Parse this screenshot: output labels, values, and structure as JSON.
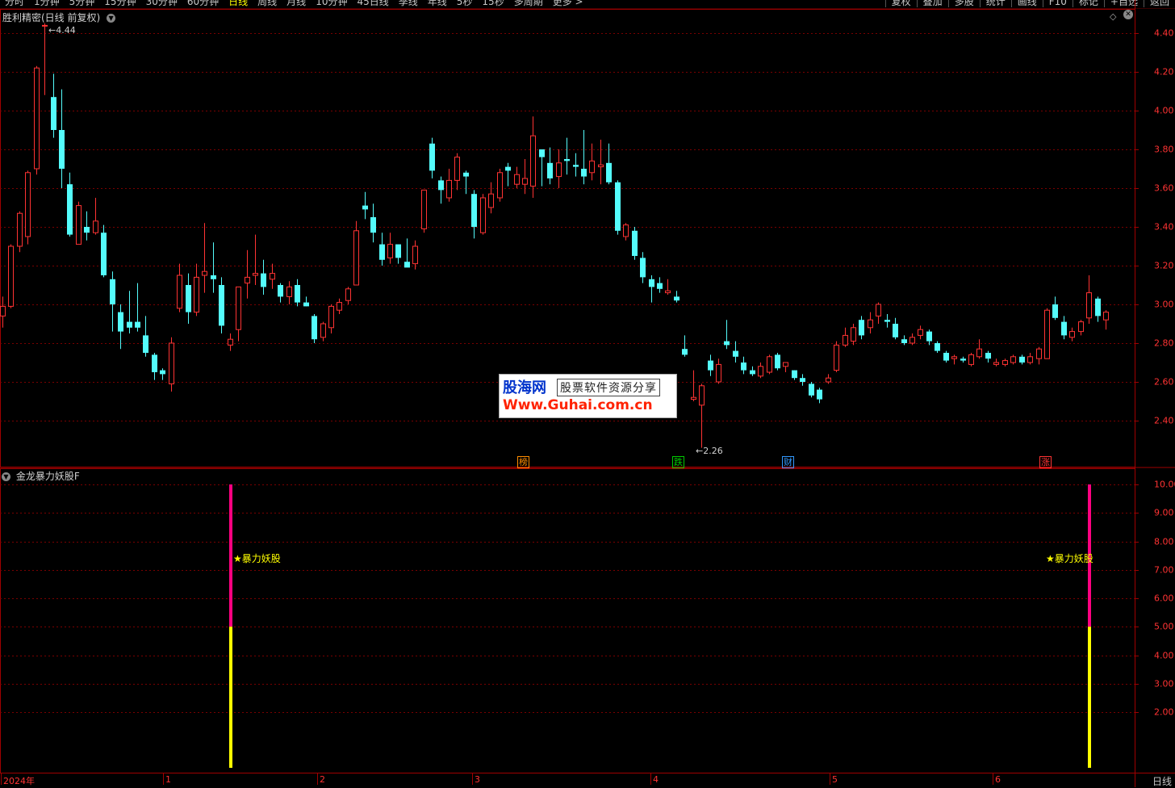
{
  "toolbar": {
    "periods": [
      "分时",
      "1分钟",
      "5分钟",
      "15分钟",
      "30分钟",
      "60分钟",
      "日线",
      "周线",
      "月线",
      "10分钟",
      "45日线",
      "季线",
      "年线",
      "5秒",
      "15秒",
      "多周期",
      "更多 >"
    ],
    "active_period": "日线",
    "tools": [
      "复权",
      "叠加",
      "多股",
      "统计",
      "画线",
      "F10",
      "标记",
      "+自选",
      "返回"
    ]
  },
  "main_panel": {
    "title": "胜利精密(日线 前复权)",
    "y_ticks": [
      "4.40",
      "4.20",
      "4.00",
      "3.80",
      "3.60",
      "3.40",
      "3.20",
      "3.00",
      "2.80",
      "2.60",
      "2.40"
    ],
    "high_label": "4.44",
    "low_label": "2.26",
    "events": [
      {
        "label": "榜",
        "color": "#ff8c00"
      },
      {
        "label": "跌",
        "color": "#00cc00"
      },
      {
        "label": "财",
        "color": "#3399ff"
      },
      {
        "label": "涨",
        "color": "#ff3333"
      }
    ]
  },
  "indicator_panel": {
    "title": "金龙暴力妖股F",
    "y_ticks": [
      "10.00",
      "9.00",
      "8.00",
      "7.00",
      "6.00",
      "5.00",
      "4.00",
      "3.00",
      "2.00"
    ],
    "signal_label": "★暴力妖股"
  },
  "x_axis": {
    "labels": [
      "2024年",
      "1",
      "2",
      "3",
      "4",
      "5",
      "6"
    ],
    "period_button": "日线"
  },
  "watermark": {
    "logo": "股海网",
    "slogan": "股票软件资源分享",
    "url": "Www.Guhai.com.cn"
  },
  "chart_data": {
    "type": "candlestick",
    "colors": {
      "up": "#ff3333",
      "down": "#54fcfc",
      "grid": "#7a0000",
      "signal_top": "#ff0080",
      "signal_bottom": "#ffff00"
    },
    "ylim": [
      2.2,
      4.5
    ],
    "candles": [
      [
        2.94,
        2.99,
        3.04,
        2.88
      ],
      [
        2.99,
        3.3,
        3.31,
        2.98
      ],
      [
        3.3,
        3.47,
        3.48,
        3.27
      ],
      [
        3.35,
        3.68,
        3.69,
        3.31
      ],
      [
        3.7,
        4.22,
        4.23,
        3.67
      ],
      [
        4.44,
        4.44,
        4.45,
        4.08
      ],
      [
        4.07,
        3.9,
        4.19,
        3.86
      ],
      [
        3.9,
        3.7,
        4.11,
        3.6
      ],
      [
        3.62,
        3.36,
        3.68,
        3.35
      ],
      [
        3.31,
        3.51,
        3.53,
        3.31
      ],
      [
        3.4,
        3.37,
        3.48,
        3.33
      ],
      [
        3.37,
        3.43,
        3.55,
        3.36
      ],
      [
        3.37,
        3.15,
        3.41,
        3.14
      ],
      [
        3.13,
        3.0,
        3.17,
        2.86
      ],
      [
        2.96,
        2.86,
        3.0,
        2.77
      ],
      [
        2.91,
        2.88,
        3.07,
        2.85
      ],
      [
        2.91,
        2.88,
        3.11,
        2.86
      ],
      [
        2.84,
        2.75,
        2.94,
        2.73
      ],
      [
        2.74,
        2.65,
        2.75,
        2.61
      ],
      [
        2.66,
        2.64,
        2.67,
        2.61
      ],
      [
        2.59,
        2.8,
        2.83,
        2.55
      ],
      [
        2.98,
        3.15,
        3.21,
        2.96
      ],
      [
        3.1,
        2.96,
        3.16,
        2.9
      ],
      [
        2.96,
        3.14,
        3.21,
        2.94
      ],
      [
        3.15,
        3.17,
        3.42,
        3.06
      ],
      [
        3.15,
        3.13,
        3.32,
        3.06
      ],
      [
        3.1,
        2.89,
        3.14,
        2.85
      ],
      [
        2.79,
        2.82,
        2.85,
        2.76
      ],
      [
        2.87,
        3.09,
        3.09,
        2.81
      ],
      [
        3.11,
        3.14,
        3.28,
        3.03
      ],
      [
        3.15,
        3.16,
        3.36,
        3.1
      ],
      [
        3.16,
        3.09,
        3.23,
        3.05
      ],
      [
        3.13,
        3.16,
        3.21,
        3.08
      ],
      [
        3.1,
        3.04,
        3.11,
        3.01
      ],
      [
        3.04,
        3.09,
        3.12,
        3.0
      ],
      [
        3.1,
        3.01,
        3.13,
        2.99
      ],
      [
        3.01,
        2.99,
        3.04,
        2.99
      ],
      [
        2.94,
        2.82,
        2.95,
        2.8
      ],
      [
        2.83,
        2.9,
        2.91,
        2.81
      ],
      [
        2.88,
        2.99,
        3.0,
        2.85
      ],
      [
        2.97,
        3.01,
        3.03,
        2.95
      ],
      [
        3.02,
        3.08,
        3.09,
        3.0
      ],
      [
        3.1,
        3.38,
        3.43,
        3.11
      ],
      [
        3.51,
        3.49,
        3.58,
        3.44
      ],
      [
        3.45,
        3.37,
        3.52,
        3.32
      ],
      [
        3.31,
        3.23,
        3.37,
        3.2
      ],
      [
        3.24,
        3.31,
        3.37,
        3.21
      ],
      [
        3.31,
        3.24,
        3.3,
        3.21
      ],
      [
        3.22,
        3.19,
        3.34,
        3.2
      ],
      [
        3.21,
        3.3,
        3.33,
        3.18
      ],
      [
        3.39,
        3.59,
        3.59,
        3.37
      ],
      [
        3.83,
        3.69,
        3.86,
        3.65
      ],
      [
        3.64,
        3.59,
        3.66,
        3.52
      ],
      [
        3.55,
        3.64,
        3.7,
        3.53
      ],
      [
        3.64,
        3.76,
        3.78,
        3.59
      ],
      [
        3.68,
        3.66,
        3.69,
        3.57
      ],
      [
        3.57,
        3.4,
        3.59,
        3.34
      ],
      [
        3.37,
        3.55,
        3.57,
        3.36
      ],
      [
        3.5,
        3.57,
        3.63,
        3.47
      ],
      [
        3.55,
        3.68,
        3.7,
        3.53
      ],
      [
        3.71,
        3.69,
        3.73,
        3.61
      ],
      [
        3.62,
        3.67,
        3.71,
        3.6
      ],
      [
        3.62,
        3.65,
        3.75,
        3.57
      ],
      [
        3.61,
        3.87,
        3.97,
        3.55
      ],
      [
        3.8,
        3.76,
        3.8,
        3.61
      ],
      [
        3.73,
        3.65,
        3.81,
        3.62
      ],
      [
        3.66,
        3.73,
        3.8,
        3.6
      ],
      [
        3.75,
        3.74,
        3.86,
        3.67
      ],
      [
        3.72,
        3.71,
        3.78,
        3.66
      ],
      [
        3.7,
        3.66,
        3.9,
        3.62
      ],
      [
        3.68,
        3.74,
        3.83,
        3.64
      ],
      [
        3.71,
        3.72,
        3.85,
        3.62
      ],
      [
        3.73,
        3.63,
        3.83,
        3.62
      ],
      [
        3.63,
        3.38,
        3.64,
        3.36
      ],
      [
        3.35,
        3.41,
        3.42,
        3.33
      ],
      [
        3.38,
        3.25,
        3.4,
        3.23
      ],
      [
        3.24,
        3.14,
        3.27,
        3.11
      ],
      [
        3.13,
        3.09,
        3.15,
        3.01
      ],
      [
        3.11,
        3.08,
        3.14,
        3.06
      ],
      [
        3.06,
        3.07,
        3.13,
        3.05
      ],
      [
        3.04,
        3.02,
        3.07,
        3.01
      ],
      [
        2.77,
        2.74,
        2.84,
        2.73
      ],
      [
        2.51,
        2.52,
        2.66,
        2.5
      ],
      [
        2.48,
        2.58,
        2.59,
        2.26
      ],
      [
        2.71,
        2.66,
        2.74,
        2.63
      ],
      [
        2.6,
        2.69,
        2.72,
        2.59
      ],
      [
        2.81,
        2.79,
        2.92,
        2.77
      ],
      [
        2.76,
        2.73,
        2.81,
        2.7
      ],
      [
        2.7,
        2.66,
        2.73,
        2.64
      ],
      [
        2.66,
        2.64,
        2.68,
        2.63
      ],
      [
        2.63,
        2.68,
        2.7,
        2.62
      ],
      [
        2.65,
        2.73,
        2.74,
        2.64
      ],
      [
        2.74,
        2.67,
        2.75,
        2.66
      ],
      [
        2.68,
        2.7,
        2.7,
        2.65
      ],
      [
        2.66,
        2.62,
        2.66,
        2.61
      ],
      [
        2.62,
        2.6,
        2.64,
        2.58
      ],
      [
        2.59,
        2.53,
        2.6,
        2.52
      ],
      [
        2.56,
        2.51,
        2.57,
        2.49
      ],
      [
        2.6,
        2.62,
        2.64,
        2.59
      ],
      [
        2.66,
        2.79,
        2.81,
        2.65
      ],
      [
        2.79,
        2.84,
        2.88,
        2.78
      ],
      [
        2.81,
        2.88,
        2.9,
        2.79
      ],
      [
        2.92,
        2.84,
        2.94,
        2.82
      ],
      [
        2.88,
        2.92,
        2.96,
        2.85
      ],
      [
        2.94,
        3.0,
        3.01,
        2.9
      ],
      [
        2.92,
        2.91,
        2.95,
        2.88
      ],
      [
        2.9,
        2.83,
        2.93,
        2.82
      ],
      [
        2.82,
        2.8,
        2.84,
        2.79
      ],
      [
        2.8,
        2.83,
        2.85,
        2.79
      ],
      [
        2.84,
        2.87,
        2.89,
        2.82
      ],
      [
        2.86,
        2.81,
        2.87,
        2.79
      ],
      [
        2.8,
        2.76,
        2.81,
        2.75
      ],
      [
        2.75,
        2.71,
        2.76,
        2.7
      ],
      [
        2.72,
        2.73,
        2.74,
        2.69
      ],
      [
        2.72,
        2.71,
        2.73,
        2.7
      ],
      [
        2.69,
        2.74,
        2.75,
        2.68
      ],
      [
        2.73,
        2.77,
        2.82,
        2.72
      ],
      [
        2.75,
        2.72,
        2.76,
        2.7
      ],
      [
        2.69,
        2.7,
        2.72,
        2.68
      ],
      [
        2.69,
        2.71,
        2.72,
        2.68
      ],
      [
        2.7,
        2.73,
        2.74,
        2.69
      ],
      [
        2.73,
        2.7,
        2.74,
        2.69
      ],
      [
        2.7,
        2.73,
        2.75,
        2.69
      ],
      [
        2.72,
        2.77,
        2.78,
        2.69
      ],
      [
        2.72,
        2.97,
        2.98,
        2.72
      ],
      [
        3.0,
        2.93,
        3.04,
        2.92
      ],
      [
        2.91,
        2.84,
        2.94,
        2.82
      ],
      [
        2.83,
        2.86,
        2.88,
        2.81
      ],
      [
        2.86,
        2.91,
        2.92,
        2.84
      ],
      [
        2.93,
        3.06,
        3.15,
        2.9
      ],
      [
        3.03,
        2.94,
        3.04,
        2.91
      ],
      [
        2.92,
        2.96,
        2.97,
        2.87
      ]
    ],
    "indicator": {
      "name": "金龙暴力妖股F",
      "signals": [
        {
          "candle_index": 27,
          "value_bottom": 5,
          "value_top": 10
        },
        {
          "candle_index": 129,
          "value_bottom": 5,
          "value_top": 10
        }
      ],
      "ylim": [
        0,
        10.5
      ]
    }
  }
}
